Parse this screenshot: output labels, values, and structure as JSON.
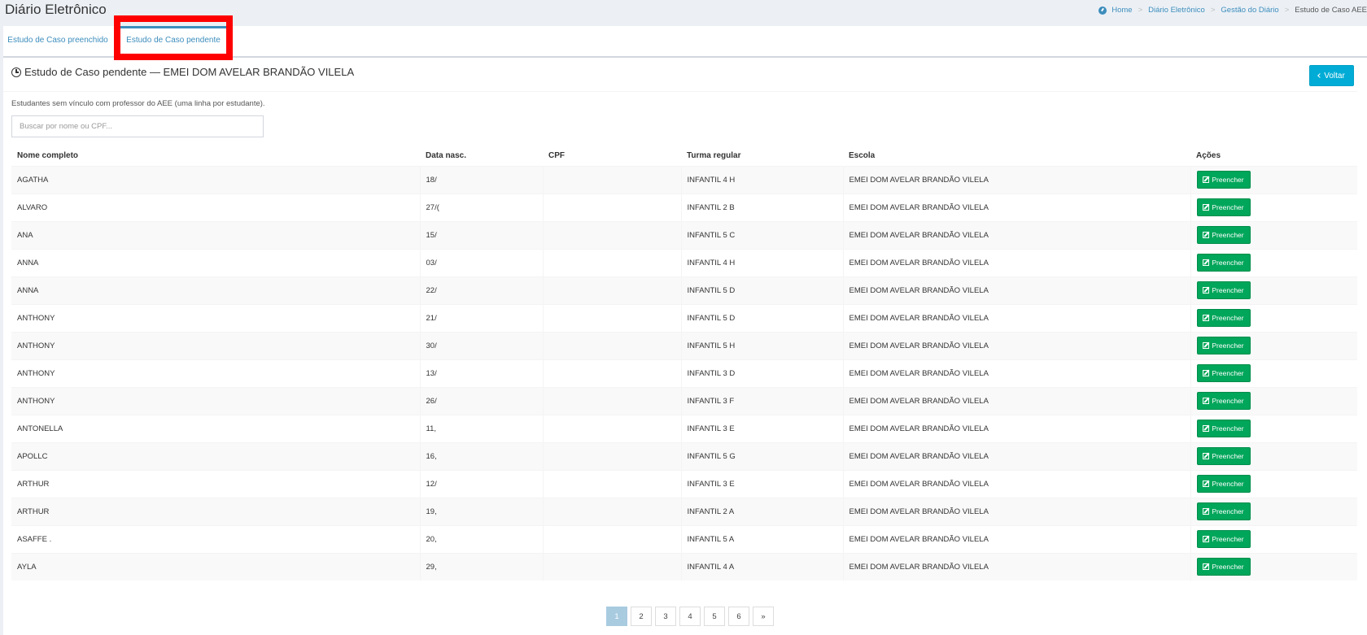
{
  "header": {
    "title": "Diário Eletrônico",
    "breadcrumb": [
      "Home",
      "Diário Eletrônico",
      "Gestão do Diário",
      "Estudo de Caso AEE"
    ]
  },
  "tabs": [
    {
      "label": "Estudo de Caso preenchido",
      "active": false
    },
    {
      "label": "Estudo de Caso pendente",
      "active": true
    }
  ],
  "box": {
    "title": "Estudo de Caso pendente — EMEI DOM AVELAR BRANDÃO VILELA",
    "back_label": "Voltar",
    "description": "Estudantes sem vínculo com professor do AEE (uma linha por estudante).",
    "search_placeholder": "Buscar por nome ou CPF..."
  },
  "table": {
    "columns": [
      "Nome completo",
      "Data nasc.",
      "CPF",
      "Turma regular",
      "Escola",
      "Ações"
    ],
    "action_label": "Preencher",
    "rows": [
      {
        "name": "AGATHA",
        "dob": "18/",
        "cpf": "",
        "turma": "INFANTIL 4 H",
        "escola": "EMEI DOM AVELAR BRANDÃO VILELA"
      },
      {
        "name": "ALVARO",
        "dob": "27/(",
        "cpf": "",
        "turma": "INFANTIL 2 B",
        "escola": "EMEI DOM AVELAR BRANDÃO VILELA"
      },
      {
        "name": "ANA",
        "dob": "15/",
        "cpf": "",
        "turma": "INFANTIL 5 C",
        "escola": "EMEI DOM AVELAR BRANDÃO VILELA"
      },
      {
        "name": "ANNA",
        "dob": "03/",
        "cpf": "",
        "turma": "INFANTIL 4 H",
        "escola": "EMEI DOM AVELAR BRANDÃO VILELA"
      },
      {
        "name": "ANNA",
        "dob": "22/",
        "cpf": "",
        "turma": "INFANTIL 5 D",
        "escola": "EMEI DOM AVELAR BRANDÃO VILELA"
      },
      {
        "name": "ANTHONY",
        "dob": "21/",
        "cpf": "",
        "turma": "INFANTIL 5 D",
        "escola": "EMEI DOM AVELAR BRANDÃO VILELA"
      },
      {
        "name": "ANTHONY",
        "dob": "30/",
        "cpf": "",
        "turma": "INFANTIL 5 H",
        "escola": "EMEI DOM AVELAR BRANDÃO VILELA"
      },
      {
        "name": "ANTHONY",
        "dob": "13/",
        "cpf": "",
        "turma": "INFANTIL 3 D",
        "escola": "EMEI DOM AVELAR BRANDÃO VILELA"
      },
      {
        "name": "ANTHONY",
        "dob": "26/",
        "cpf": "",
        "turma": "INFANTIL 3 F",
        "escola": "EMEI DOM AVELAR BRANDÃO VILELA"
      },
      {
        "name": "ANTONELLA",
        "dob": "11,",
        "cpf": "",
        "turma": "INFANTIL 3 E",
        "escola": "EMEI DOM AVELAR BRANDÃO VILELA"
      },
      {
        "name": "APOLLC",
        "dob": "16,",
        "cpf": "",
        "turma": "INFANTIL 5 G",
        "escola": "EMEI DOM AVELAR BRANDÃO VILELA"
      },
      {
        "name": "ARTHUR",
        "dob": "12/",
        "cpf": "",
        "turma": "INFANTIL 3 E",
        "escola": "EMEI DOM AVELAR BRANDÃO VILELA"
      },
      {
        "name": "ARTHUR",
        "dob": "19,",
        "cpf": "",
        "turma": "INFANTIL 2 A",
        "escola": "EMEI DOM AVELAR BRANDÃO VILELA"
      },
      {
        "name": "ASAFFE .",
        "dob": "20,",
        "cpf": "",
        "turma": "INFANTIL 5 A",
        "escola": "EMEI DOM AVELAR BRANDÃO VILELA"
      },
      {
        "name": "AYLA",
        "dob": "29,",
        "cpf": "",
        "turma": "INFANTIL 4 A",
        "escola": "EMEI DOM AVELAR BRANDÃO VILELA"
      }
    ]
  },
  "pagination": {
    "pages": [
      "1",
      "2",
      "3",
      "4",
      "5",
      "6",
      "»"
    ],
    "active": "1"
  },
  "colors": {
    "primary": "#3c8dbc",
    "info": "#00acd6",
    "success": "#00a65a",
    "highlight": "#ff0000"
  }
}
